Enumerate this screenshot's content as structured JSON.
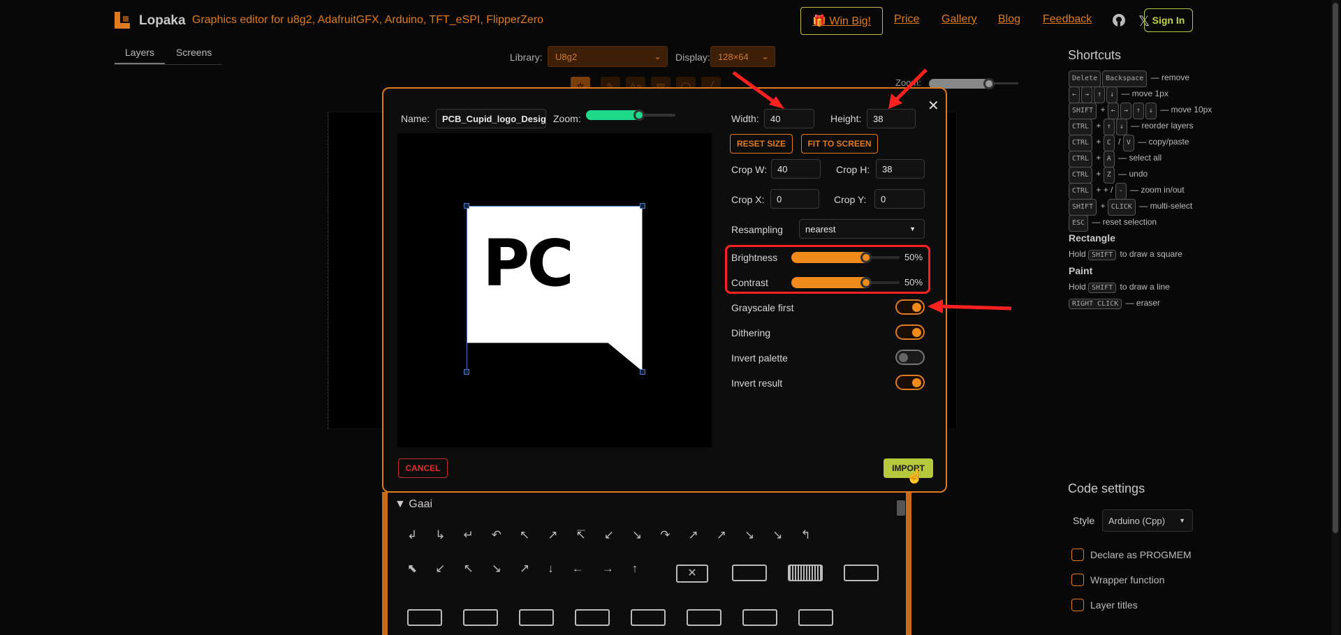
{
  "header": {
    "app_name": "Lopaka",
    "tagline": "Graphics editor for u8g2, AdafruitGFX, Arduino, TFT_eSPI, FlipperZero",
    "win_label": "🎁 Win Big!",
    "links": [
      "Price",
      "Gallery",
      "Blog",
      "Feedback"
    ],
    "signin_label": "Sign In",
    "accent_color": "#e07b1f"
  },
  "tabs": [
    "Layers",
    "Screens"
  ],
  "toolbar": {
    "library_label": "Library:",
    "library_value": "U8g2",
    "display_label": "Display:",
    "display_value": "128×64",
    "zoom_label": "Zoom:"
  },
  "modal": {
    "name_label": "Name:",
    "name_value": "PCB_Cupid_logo_Design.",
    "zoom_label": "Zoom:",
    "zoom_level": 0.8,
    "width_label": "Width:",
    "width_value": "40",
    "height_label": "Height:",
    "height_value": "38",
    "reset_size_label": "RESET SIZE",
    "fit_to_screen_label": "FIT TO SCREEN",
    "crop_w_label": "Crop W:",
    "crop_w_value": "40",
    "crop_h_label": "Crop H:",
    "crop_h_value": "38",
    "crop_x_label": "Crop X:",
    "crop_x_value": "0",
    "crop_y_label": "Crop Y:",
    "crop_y_value": "0",
    "resampling_label": "Resampling",
    "resampling_value": "nearest",
    "brightness_label": "Brightness",
    "brightness_value": "50%",
    "brightness_level": 0.73,
    "contrast_label": "Contrast",
    "contrast_value": "50%",
    "contrast_level": 0.73,
    "grayscale_label": "Grayscale first",
    "grayscale_on": true,
    "dithering_label": "Dithering",
    "dithering_on": true,
    "invert_palette_label": "Invert palette",
    "invert_palette_on": false,
    "invert_result_label": "Invert result",
    "invert_result_on": true,
    "cancel_label": "CANCEL",
    "import_label": "IMPORT",
    "preview_text": "PC"
  },
  "gallery": {
    "section_title": "▼ Gaai",
    "row1_icons": [
      "↲",
      "↳",
      "↵",
      "↶",
      "↖",
      "↗",
      "↸",
      "↙",
      "↘",
      "↷",
      "↗",
      "↗",
      "↘",
      "↘",
      "↰"
    ],
    "row2_icons": [
      "⬉",
      "↙",
      "↖",
      "↘",
      "↗",
      "↓",
      "←",
      "→",
      "↑"
    ]
  },
  "shortcuts": {
    "title": "Shortcuts",
    "lines": [
      {
        "keys": [
          "Delete",
          "Backspace"
        ],
        "text": "— remove"
      },
      {
        "keys": [
          "←",
          "→",
          "↑",
          "↓"
        ],
        "text": "— move 1px"
      },
      {
        "keys": [
          "SHIFT",
          "+",
          "←",
          "→",
          "↑",
          "↓"
        ],
        "text": "— move 10px"
      },
      {
        "keys": [
          "CTRL",
          "+",
          "↑",
          "↓"
        ],
        "text": "— reorder layers"
      },
      {
        "keys": [
          "CTRL",
          "+",
          "C",
          "/",
          "V"
        ],
        "text": "— copy/paste"
      },
      {
        "keys": [
          "CTRL",
          "+",
          "A"
        ],
        "text": "— select all"
      },
      {
        "keys": [
          "CTRL",
          "+",
          "Z"
        ],
        "text": "— undo"
      },
      {
        "keys": [
          "CTRL",
          "+",
          "+",
          "/",
          "-"
        ],
        "text": "— zoom in/out"
      },
      {
        "keys": [
          "SHIFT",
          "+",
          "CLICK"
        ],
        "text": "— multi-select"
      },
      {
        "keys": [
          "ESC"
        ],
        "text": "— reset selection"
      }
    ],
    "rectangle_title": "Rectangle",
    "rectangle_pre": "Hold",
    "rectangle_key": "SHIFT",
    "rectangle_post": "to draw a square",
    "paint_title": "Paint",
    "paint_line1_pre": "Hold",
    "paint_line1_key": "SHIFT",
    "paint_line1_post": "to draw a line",
    "paint_line2_key": "RIGHT CLICK",
    "paint_line2_post": "— eraser"
  },
  "code_settings": {
    "title": "Code settings",
    "style_label": "Style",
    "style_value": "Arduino (Cpp)",
    "options": [
      "Declare as PROGMEM",
      "Wrapper function",
      "Layer titles"
    ]
  }
}
